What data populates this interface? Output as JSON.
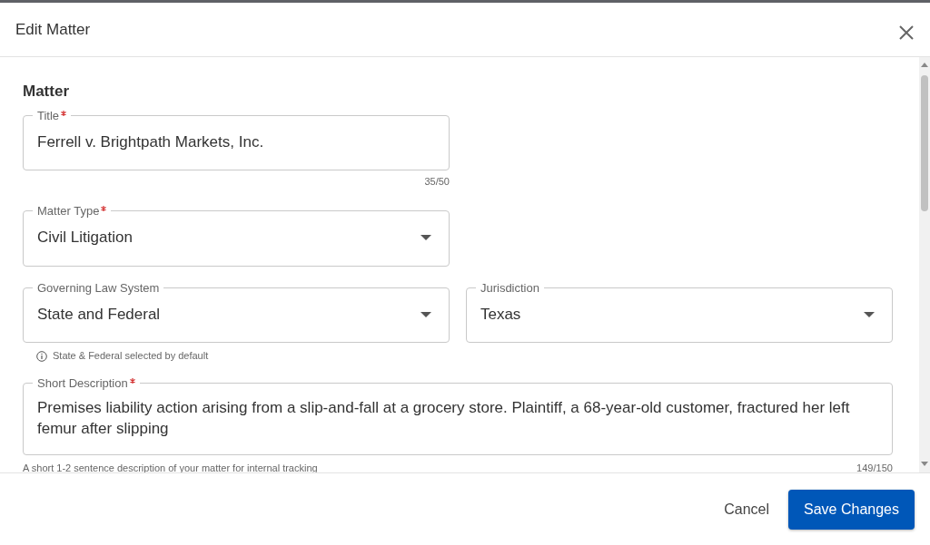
{
  "dialog": {
    "title": "Edit Matter"
  },
  "section_title": "Matter",
  "rows": [
    {
      "fields": [
        {
          "kind": "text",
          "label": "Title",
          "required": true,
          "value": "Ferrell v. Brightpath Markets, Inc.",
          "counter": "35/50"
        }
      ]
    },
    {
      "fields": [
        {
          "kind": "select",
          "label": "Matter Type",
          "required": true,
          "value": "Civil Litigation"
        }
      ]
    },
    {
      "fields": [
        {
          "kind": "select",
          "label": "Governing Law System",
          "required": false,
          "value": "State and Federal",
          "hint": "State & Federal selected by default"
        },
        {
          "kind": "select",
          "label": "Jurisdiction",
          "required": false,
          "value": "Texas"
        }
      ]
    },
    {
      "fields": [
        {
          "kind": "textarea",
          "label": "Short Description",
          "required": true,
          "value": "Premises liability action arising from a slip-and-fall at a grocery store. Plaintiff, a 68-year-old customer, fractured her left femur after slipping",
          "hint": "A short 1-2 sentence description of your matter for internal tracking",
          "counter": "149/150"
        }
      ]
    }
  ],
  "footer": {
    "buttons": [
      {
        "kind": "secondary",
        "label": "Cancel"
      },
      {
        "kind": "primary",
        "label": "Save Changes"
      }
    ]
  }
}
